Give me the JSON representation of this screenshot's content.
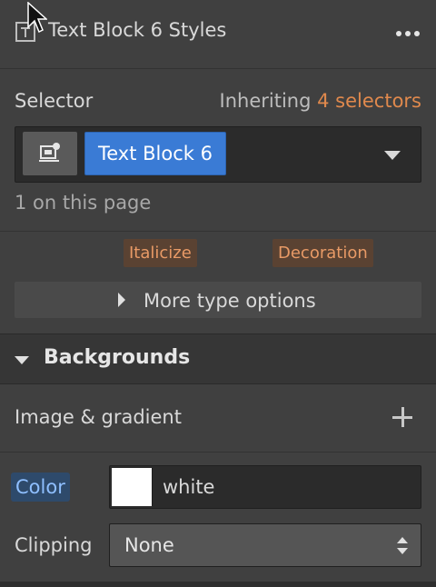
{
  "panel": {
    "title": "Text Block 6 Styles",
    "more_icon": "ellipsis-icon",
    "title_icon": "text-block-icon"
  },
  "selector": {
    "label": "Selector",
    "inheriting_prefix": "Inheriting",
    "inheriting_link": "4 selectors",
    "chip": "Text Block 6",
    "on_page": "1 on this page"
  },
  "typography": {
    "italicize": "Italicize",
    "decoration": "Decoration",
    "more_options": "More type options"
  },
  "backgrounds": {
    "section_title": "Backgrounds",
    "image_gradient_label": "Image & gradient",
    "color_label": "Color",
    "color_value": "white",
    "swatch_color": "#ffffff",
    "clipping_label": "Clipping",
    "clipping_value": "None"
  },
  "colors": {
    "accent": "#e0894d",
    "selector_chip": "#3a7bd5",
    "panel_bg": "#404040"
  }
}
